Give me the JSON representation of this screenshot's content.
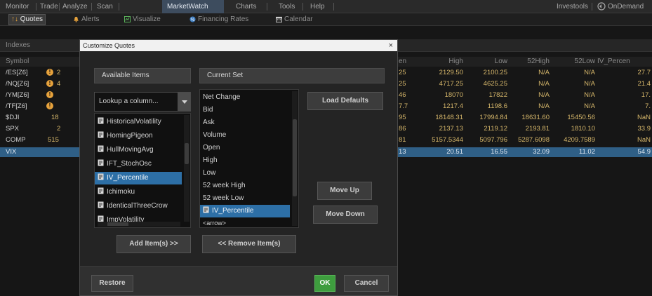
{
  "topnav": {
    "tabs": [
      "Monitor",
      "Trade",
      "Analyze",
      "Scan",
      "MarketWatch",
      "Charts",
      "Tools",
      "Help"
    ],
    "active": "MarketWatch",
    "right": [
      "Investools",
      "OnDemand"
    ]
  },
  "subnav": {
    "items": [
      "Quotes",
      "Alerts",
      "Visualize",
      "Financing Rates",
      "Calendar"
    ]
  },
  "indexes_label": "Indexes",
  "grid": {
    "headers": {
      "symbol": "Symbol",
      "open": "en",
      "high": "High",
      "low": "Low",
      "h52": "52High",
      "l52": "52Low",
      "ivp": "IV_Percen"
    },
    "rows": [
      {
        "symbol": "/ES[Z6]",
        "warn": true,
        "c2": "2",
        "open": "25",
        "high": "2129.50",
        "low": "2100.25",
        "h52": "N/A",
        "l52": "N/A",
        "ivp": "27.7"
      },
      {
        "symbol": "/NQ[Z6]",
        "warn": true,
        "c2": "4",
        "open": "25",
        "high": "4717.25",
        "low": "4625.25",
        "h52": "N/A",
        "l52": "N/A",
        "ivp": "21.4"
      },
      {
        "symbol": "/YM[Z6]",
        "warn": true,
        "c2": "",
        "open": "46",
        "high": "18070",
        "low": "17822",
        "h52": "N/A",
        "l52": "N/A",
        "ivp": "17."
      },
      {
        "symbol": "/TF[Z6]",
        "warn": true,
        "c2": "",
        "open": "7.7",
        "high": "1217.4",
        "low": "1198.6",
        "h52": "N/A",
        "l52": "N/A",
        "ivp": "7."
      },
      {
        "symbol": "$DJI",
        "warn": false,
        "c2": "18",
        "open": "95",
        "high": "18148.31",
        "low": "17994.84",
        "h52": "18631.60",
        "l52": "15450.56",
        "ivp": "NaN"
      },
      {
        "symbol": "SPX",
        "warn": false,
        "c2": "2",
        "open": "86",
        "high": "2137.13",
        "low": "2119.12",
        "h52": "2193.81",
        "l52": "1810.10",
        "ivp": "33.9"
      },
      {
        "symbol": "COMP",
        "warn": false,
        "c2": "515",
        "open": "81",
        "high": "5157.5344",
        "low": "5097.796",
        "h52": "5287.6098",
        "l52": "4209.7589",
        "ivp": "NaN"
      },
      {
        "symbol": "VIX",
        "warn": false,
        "c2": "",
        "open": "13",
        "high": "20.51",
        "low": "16.55",
        "h52": "32.09",
        "l52": "11.02",
        "ivp": "54.9"
      }
    ]
  },
  "dialog": {
    "title": "Customize Quotes",
    "close": "×",
    "available_header": "Available Items",
    "current_header": "Current Set",
    "lookup_placeholder": "Lookup a column...",
    "available_items": [
      "HistoricalVolatility",
      "HomingPigeon",
      "HullMovingAvg",
      "IFT_StochOsc",
      "IV_Percentile",
      "Ichimoku",
      "IdenticalThreeCrow",
      "ImpVolatility"
    ],
    "available_selected": "IV_Percentile",
    "current_items": [
      "Net Change",
      "Bid",
      "Ask",
      "Volume",
      "Open",
      "High",
      "Low",
      "52 week High",
      "52 week Low",
      "IV_Percentile",
      "<arrow>"
    ],
    "current_selected": "IV_Percentile",
    "buttons": {
      "load_defaults": "Load Defaults",
      "move_up": "Move Up",
      "move_down": "Move Down",
      "add": "Add Item(s) >>",
      "remove": "<< Remove Item(s)",
      "restore": "Restore",
      "ok": "OK",
      "cancel": "Cancel"
    }
  },
  "colors": {
    "accent": "#2d6fa6",
    "ok": "#3e9d3e",
    "number": "#d5b66a",
    "warning": "#e6a23c"
  }
}
